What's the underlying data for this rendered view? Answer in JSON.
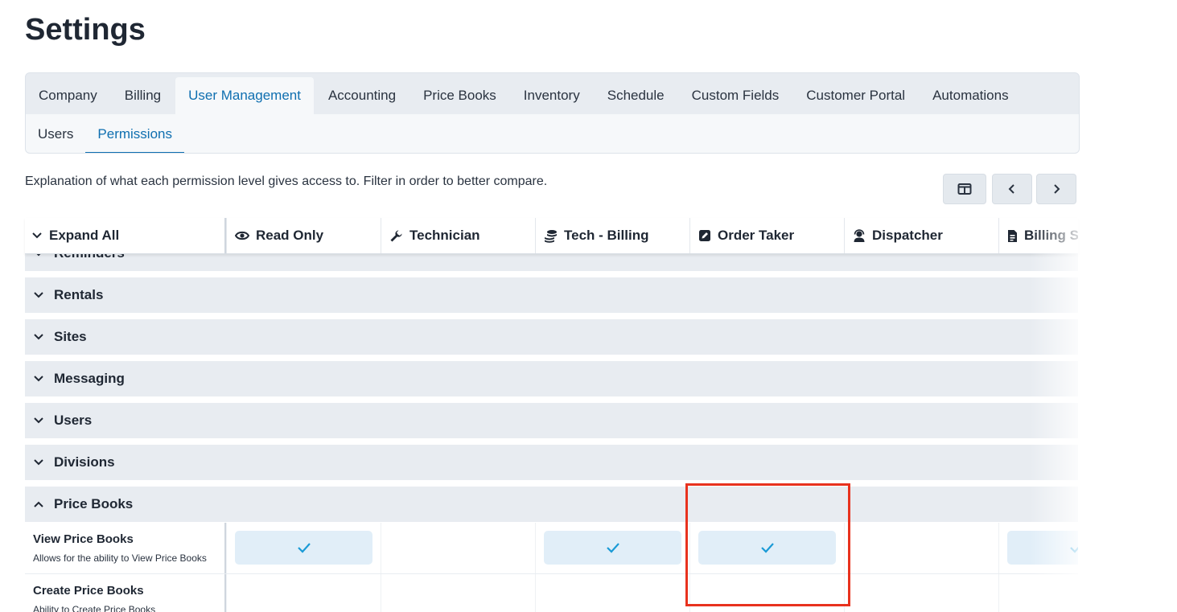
{
  "page": {
    "title": "Settings"
  },
  "main_tabs": [
    "Company",
    "Billing",
    "User Management",
    "Accounting",
    "Price Books",
    "Inventory",
    "Schedule",
    "Custom Fields",
    "Customer Portal",
    "Automations"
  ],
  "active_main_tab": "User Management",
  "sub_tabs": [
    "Users",
    "Permissions"
  ],
  "active_sub_tab": "Permissions",
  "description": "Explanation of what each permission level gives access to. Filter in order to better compare.",
  "table": {
    "expand_all_label": "Expand All",
    "columns": [
      {
        "label": "Read Only",
        "icon": "eye-icon"
      },
      {
        "label": "Technician",
        "icon": "wrench-icon"
      },
      {
        "label": "Tech - Billing",
        "icon": "coins-icon"
      },
      {
        "label": "Order Taker",
        "icon": "edit-icon"
      },
      {
        "label": "Dispatcher",
        "icon": "headset-icon"
      },
      {
        "label": "Billing St",
        "icon": "file-invoice-icon"
      }
    ],
    "groups": [
      {
        "label": "Reminders",
        "expanded": false
      },
      {
        "label": "Rentals",
        "expanded": false
      },
      {
        "label": "Sites",
        "expanded": false
      },
      {
        "label": "Messaging",
        "expanded": false
      },
      {
        "label": "Users",
        "expanded": false
      },
      {
        "label": "Divisions",
        "expanded": false
      },
      {
        "label": "Price Books",
        "expanded": true
      }
    ],
    "permissions": [
      {
        "name": "View Price Books",
        "description": "Allows for the ability to View Price Books",
        "checks": [
          true,
          false,
          true,
          true,
          false,
          true
        ]
      },
      {
        "name": "Create Price Books",
        "description": "Ability to Create Price Books",
        "checks": [
          false,
          false,
          false,
          false,
          false,
          false
        ]
      }
    ]
  },
  "colors": {
    "accent": "#0f6fb0",
    "check": "#1a9ad6",
    "highlight": "#e8321e",
    "group_bg": "#e8ecf1"
  }
}
